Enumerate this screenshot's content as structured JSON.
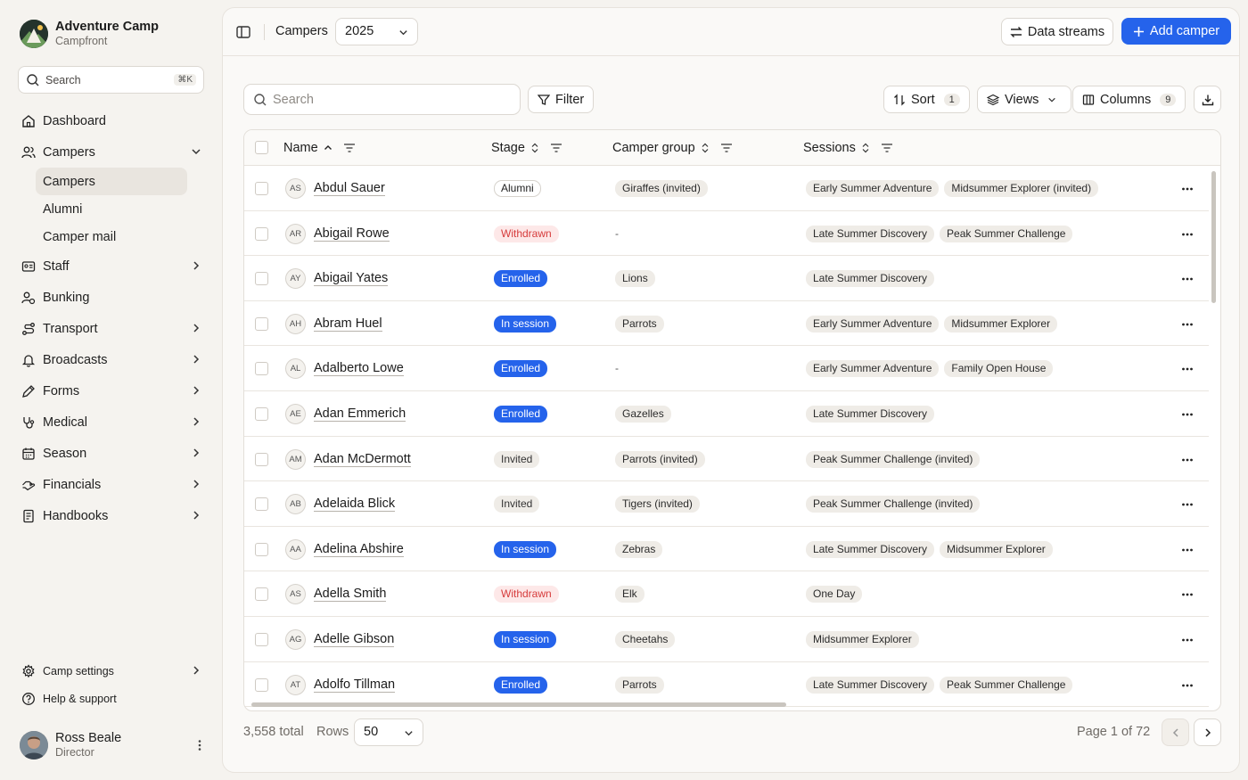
{
  "brand": {
    "name": "Adventure Camp",
    "subtitle": "Campfront"
  },
  "sidebar_search": {
    "placeholder": "Search",
    "shortcut": "⌘K"
  },
  "nav": {
    "dashboard": "Dashboard",
    "campers": "Campers",
    "campers_sub": [
      "Campers",
      "Alumni",
      "Camper mail"
    ],
    "staff": "Staff",
    "bunking": "Bunking",
    "transport": "Transport",
    "broadcasts": "Broadcasts",
    "forms": "Forms",
    "medical": "Medical",
    "season": "Season",
    "financials": "Financials",
    "handbooks": "Handbooks",
    "camp_settings": "Camp settings",
    "help": "Help & support"
  },
  "user": {
    "name": "Ross Beale",
    "role": "Director"
  },
  "topbar": {
    "title": "Campers",
    "year": "2025",
    "data_streams": "Data streams",
    "add_camper": "Add camper"
  },
  "toolbar": {
    "search_placeholder": "Search",
    "filter": "Filter",
    "sort": "Sort",
    "sort_count": "1",
    "views": "Views",
    "columns": "Columns",
    "columns_count": "9"
  },
  "table": {
    "headers": {
      "name": "Name",
      "stage": "Stage",
      "group": "Camper group",
      "sessions": "Sessions"
    },
    "rows": [
      {
        "initials": "AS",
        "name": "Abdul Sauer",
        "stage": "Alumni",
        "group": "Giraffes (invited)",
        "sessions": [
          "Early Summer Adventure",
          "Midsummer Explorer (invited)"
        ]
      },
      {
        "initials": "AR",
        "name": "Abigail Rowe",
        "stage": "Withdrawn",
        "group": "-",
        "sessions": [
          "Late Summer Discovery",
          "Peak Summer Challenge"
        ]
      },
      {
        "initials": "AY",
        "name": "Abigail Yates",
        "stage": "Enrolled",
        "group": "Lions",
        "sessions": [
          "Late Summer Discovery"
        ]
      },
      {
        "initials": "AH",
        "name": "Abram Huel",
        "stage": "In session",
        "group": "Parrots",
        "sessions": [
          "Early Summer Adventure",
          "Midsummer Explorer"
        ]
      },
      {
        "initials": "AL",
        "name": "Adalberto Lowe",
        "stage": "Enrolled",
        "group": "-",
        "sessions": [
          "Early Summer Adventure",
          "Family Open House"
        ]
      },
      {
        "initials": "AE",
        "name": "Adan Emmerich",
        "stage": "Enrolled",
        "group": "Gazelles",
        "sessions": [
          "Late Summer Discovery"
        ]
      },
      {
        "initials": "AM",
        "name": "Adan McDermott",
        "stage": "Invited",
        "group": "Parrots (invited)",
        "sessions": [
          "Peak Summer Challenge (invited)"
        ]
      },
      {
        "initials": "AB",
        "name": "Adelaida Blick",
        "stage": "Invited",
        "group": "Tigers (invited)",
        "sessions": [
          "Peak Summer Challenge (invited)"
        ]
      },
      {
        "initials": "AA",
        "name": "Adelina Abshire",
        "stage": "In session",
        "group": "Zebras",
        "sessions": [
          "Late Summer Discovery",
          "Midsummer Explorer"
        ]
      },
      {
        "initials": "AS",
        "name": "Adella Smith",
        "stage": "Withdrawn",
        "group": "Elk",
        "sessions": [
          "One Day"
        ]
      },
      {
        "initials": "AG",
        "name": "Adelle Gibson",
        "stage": "In session",
        "group": "Cheetahs",
        "sessions": [
          "Midsummer Explorer"
        ]
      },
      {
        "initials": "AT",
        "name": "Adolfo Tillman",
        "stage": "Enrolled",
        "group": "Parrots",
        "sessions": [
          "Late Summer Discovery",
          "Peak Summer Challenge"
        ]
      }
    ]
  },
  "footer": {
    "total": "3,558 total",
    "rows_label": "Rows",
    "rows_value": "50",
    "page": "Page 1 of 72"
  },
  "colors": {
    "accent": "#2563eb",
    "withdrawn_bg": "#fde8e8",
    "withdrawn_text": "#d63b3b",
    "background": "#f5f3ef"
  }
}
